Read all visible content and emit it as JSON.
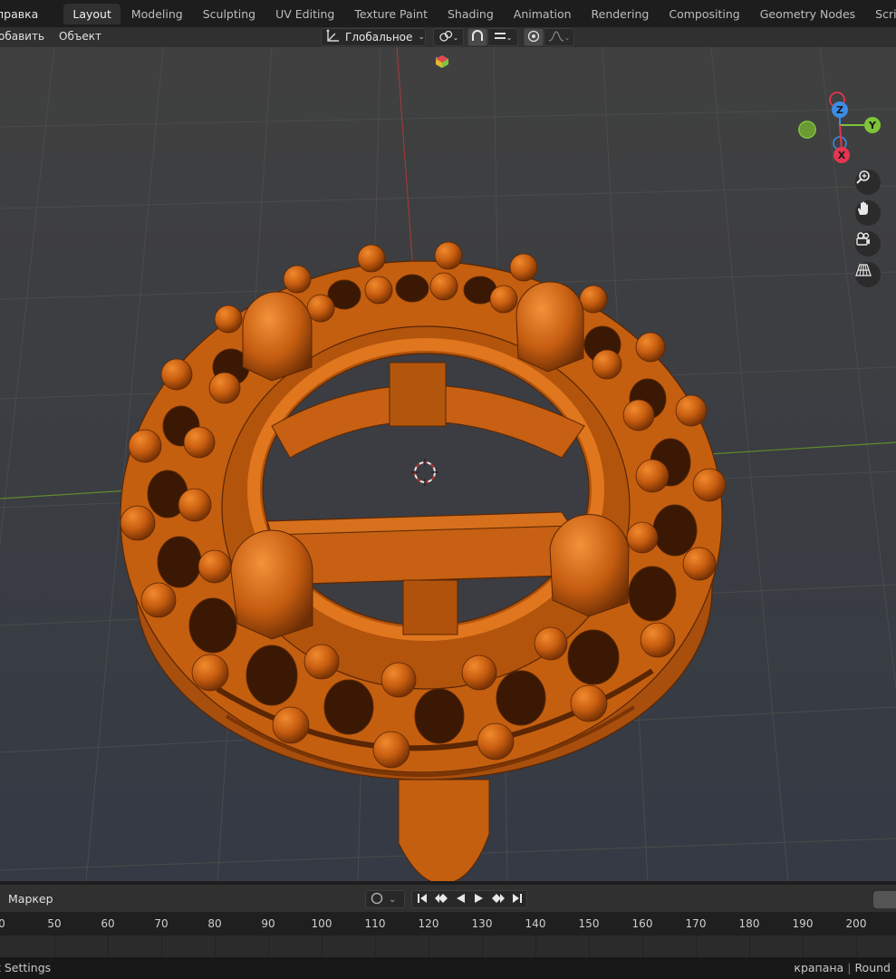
{
  "topbar": {
    "menu_help": "правка",
    "workspace_tabs": [
      "Layout",
      "Modeling",
      "Sculpting",
      "UV Editing",
      "Texture Paint",
      "Shading",
      "Animation",
      "Rendering",
      "Compositing",
      "Geometry Nodes",
      "Scripting"
    ],
    "active_tab": "Layout"
  },
  "viewport_header": {
    "menu_add": "обавить",
    "menu_object": "Объект",
    "orientation": "Глобальное",
    "icons": [
      "transform-orientation-icon",
      "pivot-icon",
      "snap-icon",
      "snap-increment-icon",
      "proportional-edit-icon",
      "falloff-icon"
    ]
  },
  "gizmo": {
    "axis_z": "Z",
    "axis_y": "Y",
    "axis_x": "X",
    "colors": {
      "x": "#e63550",
      "y": "#7ec43a",
      "z": "#3c8ce6"
    }
  },
  "nav_icons": [
    "zoom-icon",
    "pan-hand-icon",
    "camera-icon",
    "perspective-grid-icon"
  ],
  "model": {
    "color": "#c45f10",
    "dark": "#5a2604",
    "description": ""
  },
  "timeline": {
    "marker_label": "Маркер",
    "frame_numbers": [
      "50",
      "60",
      "70",
      "80",
      "90",
      "100",
      "110",
      "120",
      "130",
      "140",
      "150",
      "160",
      "170",
      "180",
      "190",
      "200"
    ],
    "first_partial": "0"
  },
  "statusbar": {
    "left": "t Settings",
    "right_a": "крапана",
    "right_b": "Round"
  }
}
